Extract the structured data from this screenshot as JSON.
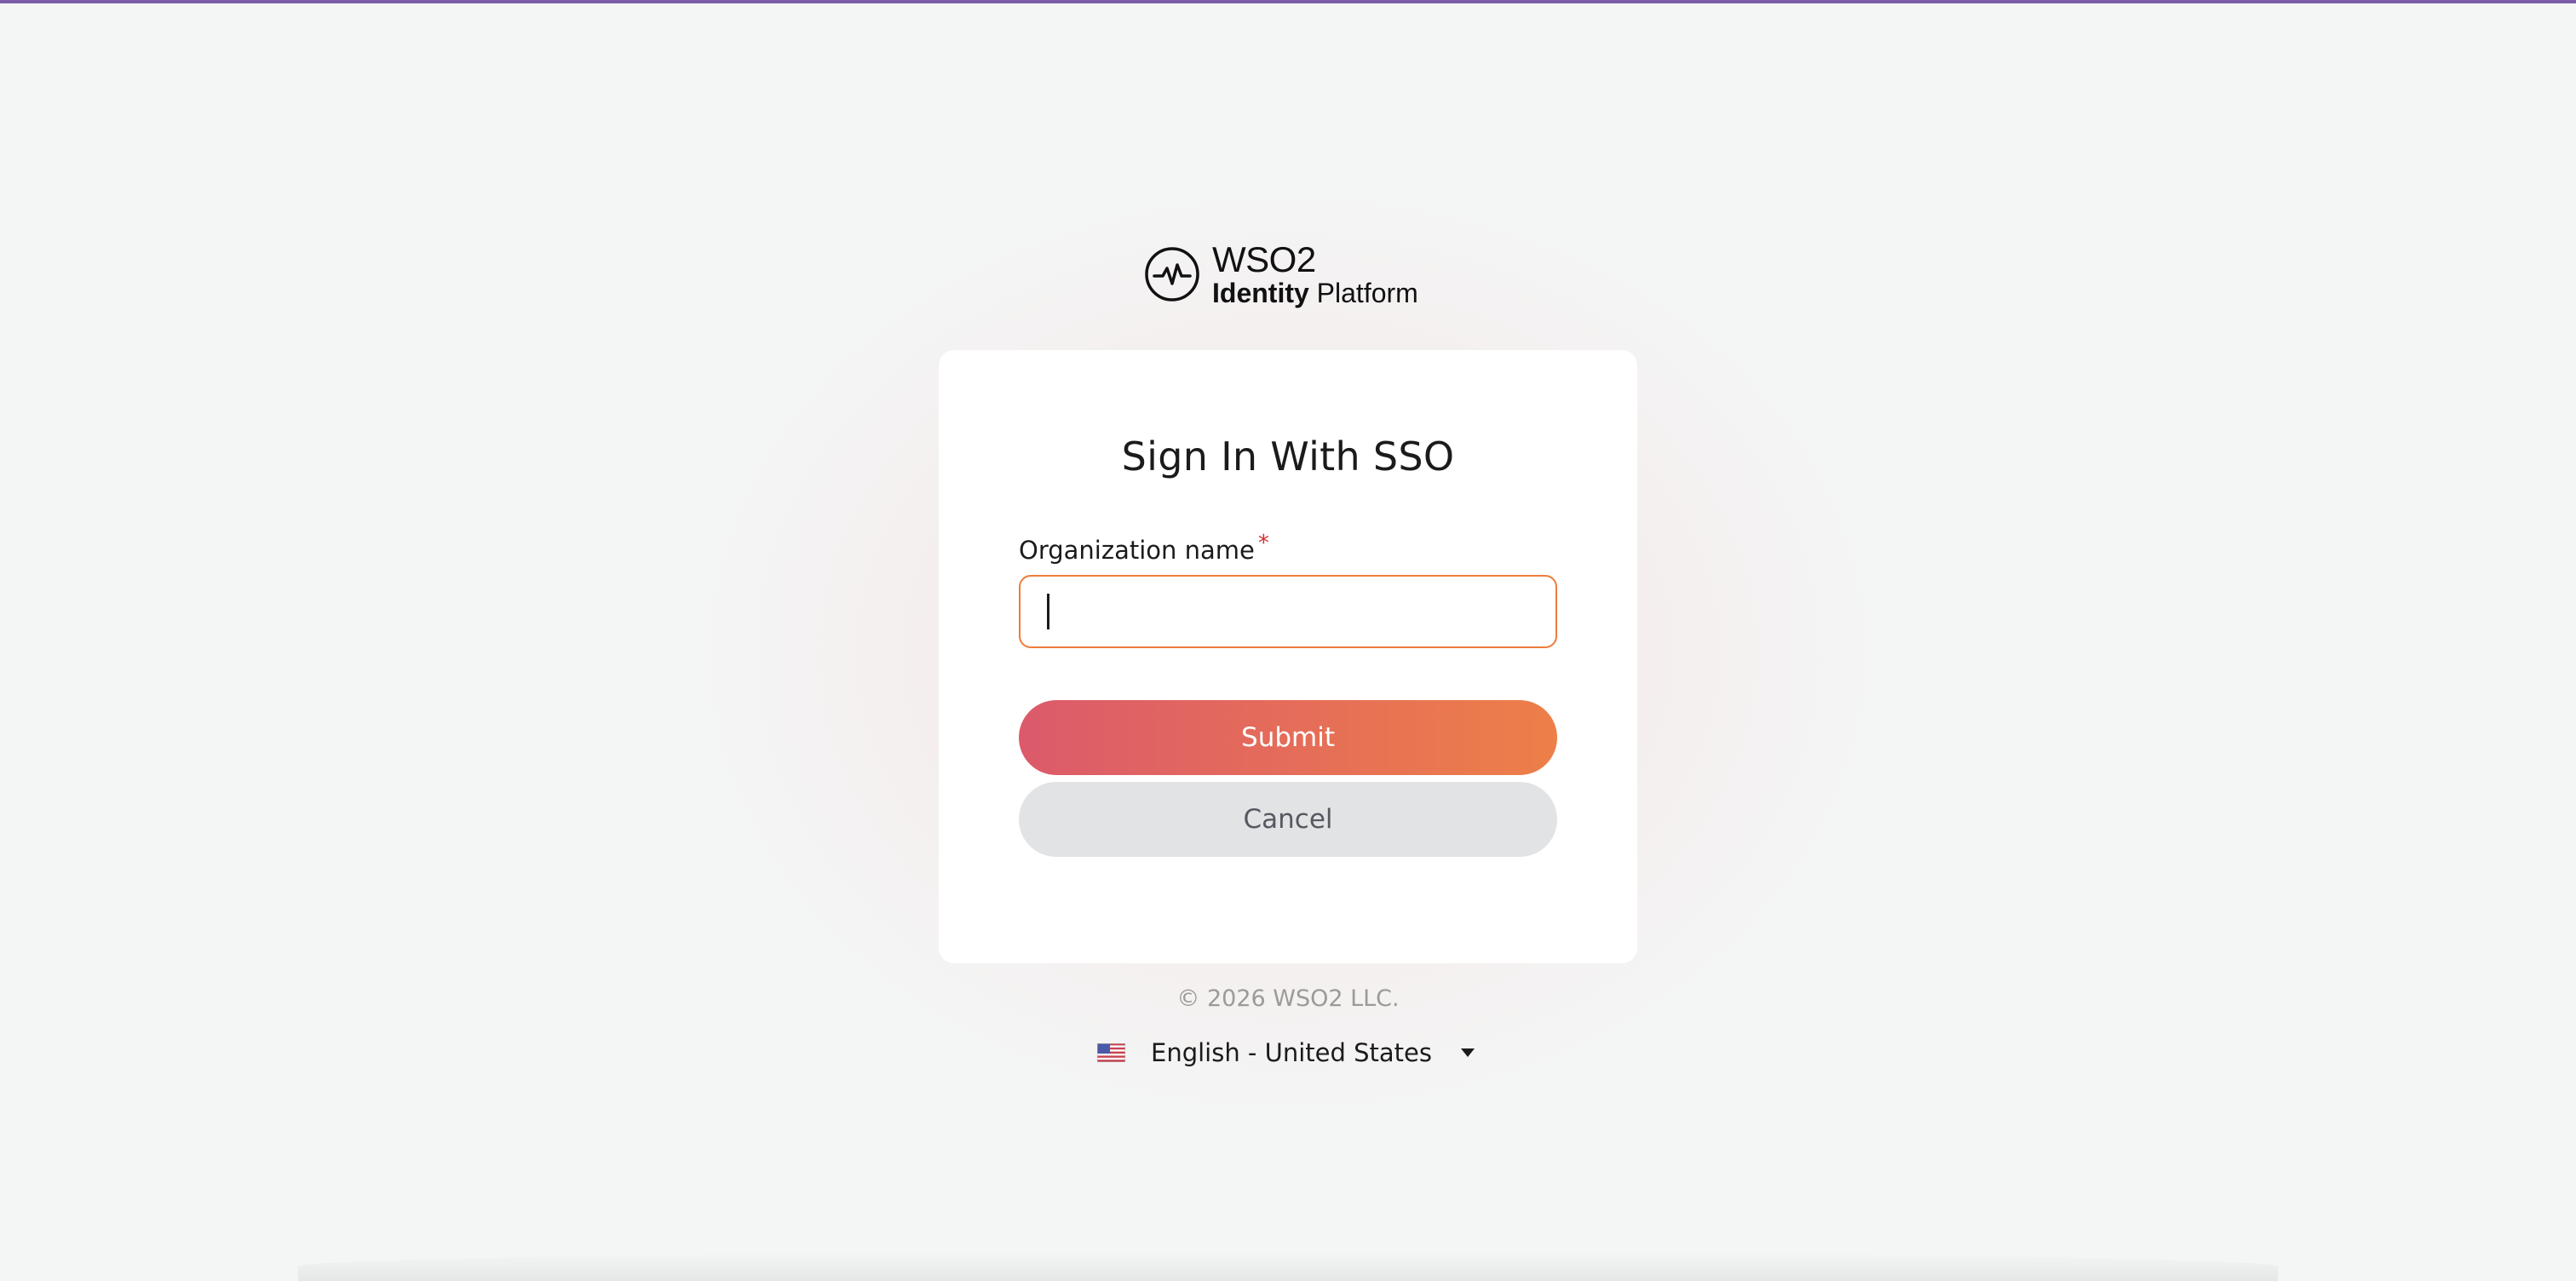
{
  "brand": {
    "name_line1": "WSO2",
    "name_line2_bold": "Identity",
    "name_line2_light": "Platform",
    "logo_icon": "pulse-circle-icon"
  },
  "form": {
    "title": "Sign In With SSO",
    "org_label": "Organization name",
    "required_marker": "*",
    "org_value": "",
    "org_placeholder": "",
    "submit_label": "Submit",
    "cancel_label": "Cancel"
  },
  "footer": {
    "copyright": "© 2026 WSO2 LLC.",
    "language": "English - United States",
    "flag_icon": "us-flag-icon",
    "dropdown_icon": "caret-down-icon"
  },
  "colors": {
    "top_bar": "#7d5ca8",
    "input_focus_border": "#ed7d3b",
    "submit_gradient_start": "#dc5a6b",
    "submit_gradient_end": "#ed7f48",
    "cancel_bg": "#e2e3e5",
    "required": "#d32f2f"
  }
}
